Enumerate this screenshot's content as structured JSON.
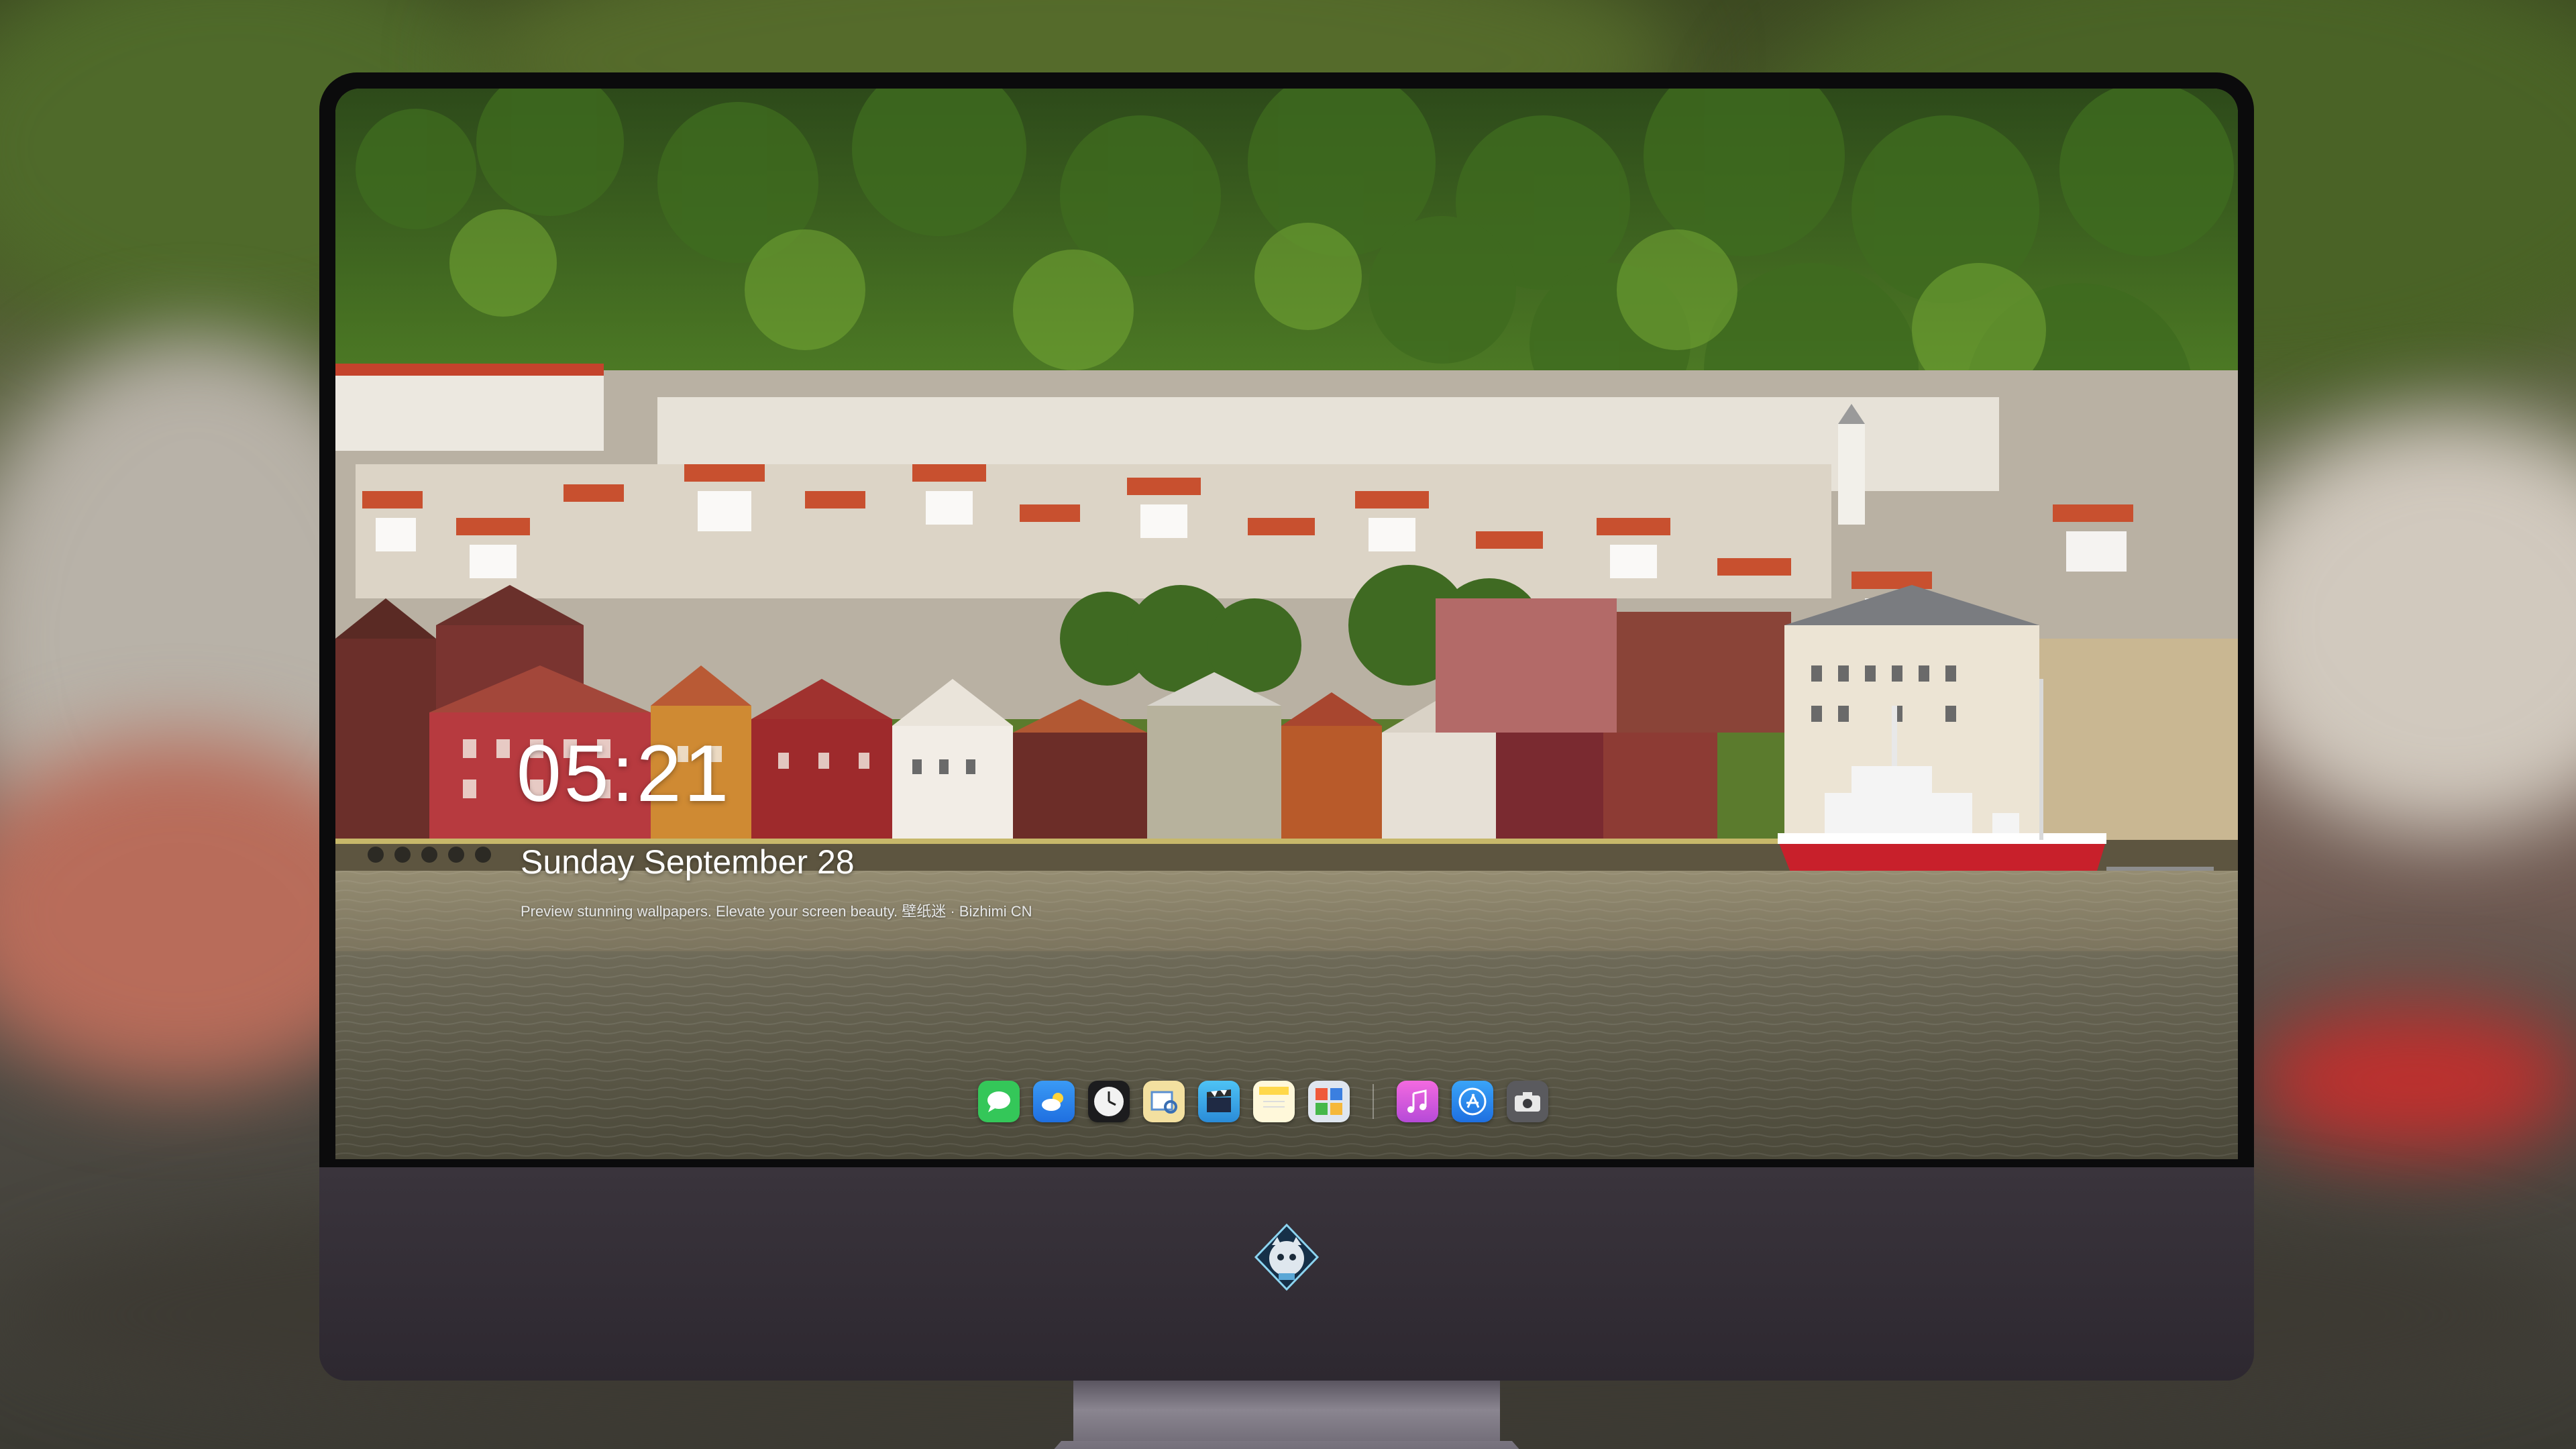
{
  "lockscreen": {
    "time": "05:21",
    "date": "Sunday September 28",
    "tagline": "Preview stunning wallpapers. Elevate your screen beauty. 壁纸迷 · Bizhimi CN"
  },
  "dock": {
    "apps": [
      {
        "name": "messages-icon",
        "color": "#34c759"
      },
      {
        "name": "weather-icon",
        "color": "#2f8cf0"
      },
      {
        "name": "clock-icon",
        "color": "#f2f2f2"
      },
      {
        "name": "preview-icon",
        "color": "#f1d46a"
      },
      {
        "name": "final-cut-icon",
        "color": "#36b6f0"
      },
      {
        "name": "notes-icon",
        "color": "#ffd84a"
      },
      {
        "name": "photo-booth-icon",
        "color": "#3b7fe0"
      },
      {
        "name": "itunes-icon",
        "color": "#e85ad0"
      },
      {
        "name": "app-store-icon",
        "color": "#2a8cf3"
      },
      {
        "name": "screenshot-icon",
        "color": "#5f5f63"
      }
    ]
  },
  "colors": {
    "bezel": "#0b0b0c",
    "chin": "#332e36",
    "text": "#ffffff"
  }
}
